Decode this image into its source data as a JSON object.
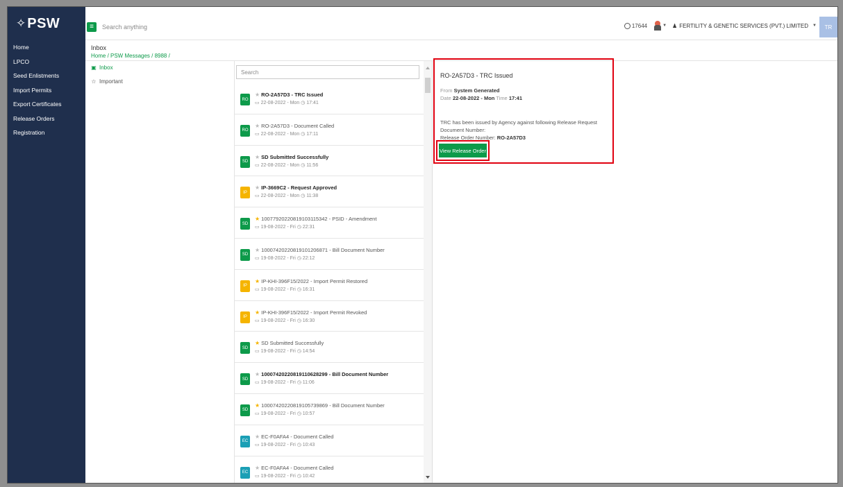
{
  "brand": {
    "glyph": "✧",
    "name": "PSW"
  },
  "topbar": {
    "search_placeholder": "Search anything",
    "counter": "17644",
    "company": "FERTILITY & GENETIC SERVICES (PVT.) LIMITED",
    "avatar_initials": "TR"
  },
  "sidebar": {
    "items": [
      {
        "label": "Home"
      },
      {
        "label": "LPCO"
      },
      {
        "label": "Seed Enlistments"
      },
      {
        "label": "Import Permits"
      },
      {
        "label": "Export Certificates"
      },
      {
        "label": "Release Orders"
      },
      {
        "label": "Registration"
      }
    ]
  },
  "breadcrumb": {
    "title": "Inbox",
    "path": "Home / PSW Messages / 8988 /"
  },
  "folders": [
    {
      "label": "Inbox",
      "icon": "inbox-icon",
      "active": true
    },
    {
      "label": "Important",
      "icon": "star-outline-icon",
      "active": false
    }
  ],
  "message_list": {
    "search_placeholder": "Search",
    "messages": [
      {
        "badge": "RO",
        "color": "#0d9a4a",
        "starred": false,
        "bold": true,
        "subject": "RO-2A57D3 - TRC Issued",
        "date": "22-08-2022 - Mon",
        "time": "17:41"
      },
      {
        "badge": "RO",
        "color": "#0d9a4a",
        "starred": false,
        "bold": false,
        "subject": "RO-2A57D3 - Document Called",
        "date": "22-08-2022 - Mon",
        "time": "17:11"
      },
      {
        "badge": "SD",
        "color": "#0d9a4a",
        "starred": false,
        "bold": true,
        "subject": "SD Submitted Successfully",
        "date": "22-08-2022 - Mon",
        "time": "11:56"
      },
      {
        "badge": "IP",
        "color": "#f5b400",
        "starred": false,
        "bold": true,
        "subject": "IP-3669C2 - Request Approved",
        "date": "22-08-2022 - Mon",
        "time": "11:38"
      },
      {
        "badge": "SD",
        "color": "#0d9a4a",
        "starred": true,
        "bold": false,
        "subject": "1007792022081910311534​2 - PSID - Amendment",
        "date": "19-08-2022 - Fri",
        "time": "22:31"
      },
      {
        "badge": "SD",
        "color": "#0d9a4a",
        "starred": false,
        "bold": false,
        "subject": "10007420220819101206871 - Bill Document Number",
        "date": "19-08-2022 - Fri",
        "time": "22:12"
      },
      {
        "badge": "IP",
        "color": "#f5b400",
        "starred": true,
        "bold": false,
        "subject": "IP-KHI-396F15/2022 - Import Permit Restored",
        "date": "19-08-2022 - Fri",
        "time": "16:31"
      },
      {
        "badge": "IP",
        "color": "#f5b400",
        "starred": true,
        "bold": false,
        "subject": "IP-KHI-396F15/2022 - Import Permit Revoked",
        "date": "19-08-2022 - Fri",
        "time": "16:30"
      },
      {
        "badge": "SD",
        "color": "#0d9a4a",
        "starred": true,
        "bold": false,
        "subject": "SD Submitted Successfully",
        "date": "19-08-2022 - Fri",
        "time": "14:54"
      },
      {
        "badge": "SD",
        "color": "#0d9a4a",
        "starred": false,
        "bold": true,
        "subject": "10007420220819110628299 - Bill Document Number",
        "date": "19-08-2022 - Fri",
        "time": "11:06"
      },
      {
        "badge": "SD",
        "color": "#0d9a4a",
        "starred": true,
        "bold": false,
        "subject": "10007420220819105739869 - Bill Document Number",
        "date": "19-08-2022 - Fri",
        "time": "10:57"
      },
      {
        "badge": "EC",
        "color": "#1b9fb5",
        "starred": false,
        "bold": false,
        "subject": "EC-F0AFA4 - Document Called",
        "date": "19-08-2022 - Fri",
        "time": "10:43"
      },
      {
        "badge": "EC",
        "color": "#1b9fb5",
        "starred": false,
        "bold": false,
        "subject": "EC-F0AFA4 - Document Called",
        "date": "19-08-2022 - Fri",
        "time": "10:42"
      }
    ]
  },
  "detail": {
    "title": "RO-2A57D3 - TRC Issued",
    "from_label": "From",
    "from_value": "System Generated",
    "date_label": "Date",
    "date_value": "22-08-2022 - Mon",
    "time_label": "Time",
    "time_value": "17:41",
    "body_line1": "TRC has been issued by Agency against following Release Request Document Number:",
    "body_line2_label": "Release Order Number:",
    "body_line2_value": "RO-2A57D3",
    "button_label": "View Release Order"
  },
  "colors": {
    "nav_bg": "#1f2f4d",
    "accent": "#0d9a4a",
    "highlight": "#e0000f"
  }
}
